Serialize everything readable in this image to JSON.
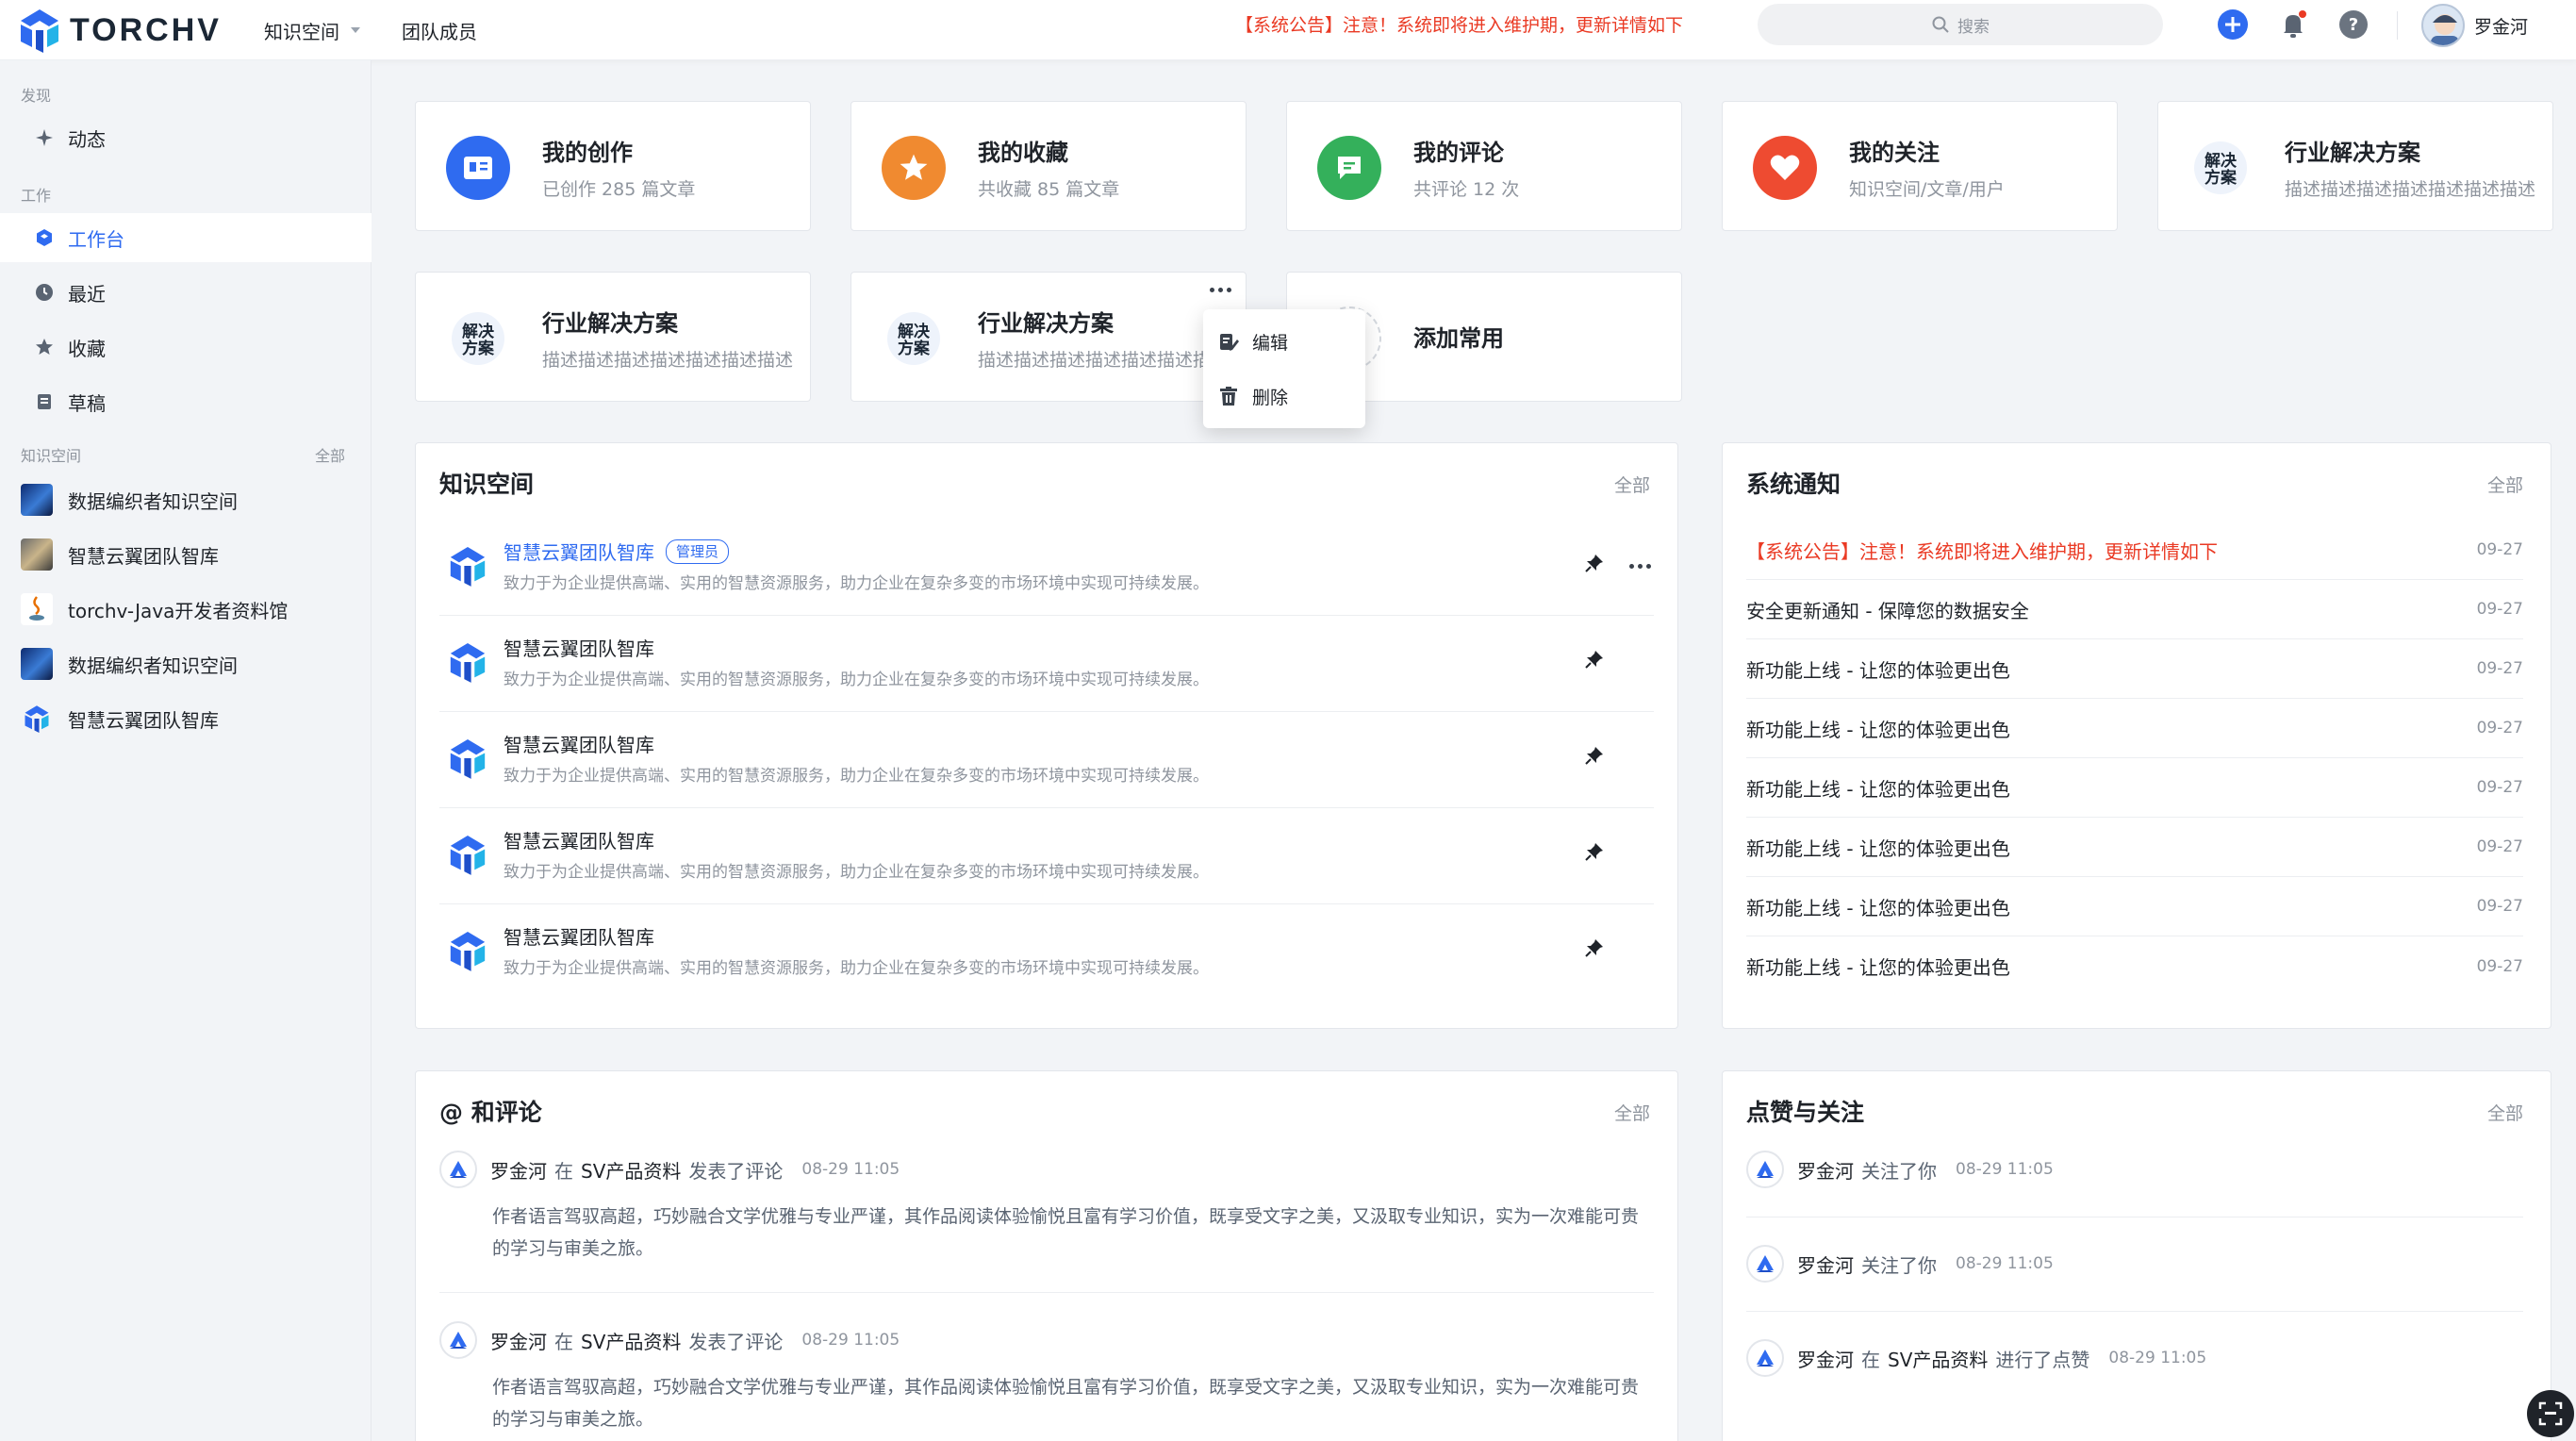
{
  "header": {
    "logo_text": "TORCHV",
    "nav": [
      {
        "label": "知识空间",
        "has_dropdown": true
      },
      {
        "label": "团队成员",
        "has_dropdown": false
      }
    ],
    "announcement": "【系统公告】注意！系统即将进入维护期，更新详情如下",
    "search_placeholder": "搜索",
    "user_name": "罗金河",
    "icons": [
      "plus-icon",
      "bell-icon",
      "help-icon"
    ]
  },
  "sidebar": {
    "section_discover": "发现",
    "discover_items": [
      {
        "label": "动态",
        "icon": "activity-icon"
      }
    ],
    "section_work": "工作",
    "work_items": [
      {
        "label": "工作台",
        "icon": "workbench-icon",
        "active": true
      },
      {
        "label": "最近",
        "icon": "clock-icon"
      },
      {
        "label": "收藏",
        "icon": "star-icon"
      },
      {
        "label": "草稿",
        "icon": "draft-icon"
      }
    ],
    "section_knowledge": "知识空间",
    "section_knowledge_all": "全部",
    "knowledge_spaces": [
      {
        "label": "数据编织者知识空间"
      },
      {
        "label": "智慧云翼团队智库"
      },
      {
        "label": "torchv-Java开发者资料馆"
      },
      {
        "label": "数据编织者知识空间"
      },
      {
        "label": "智慧云翼团队智库"
      }
    ]
  },
  "quick_cards": [
    {
      "title": "我的创作",
      "subtitle": "已创作 285 篇文章",
      "color": "#2f6bf0",
      "icon": "book-icon"
    },
    {
      "title": "我的收藏",
      "subtitle": "共收藏 85 篇文章",
      "color": "#f08a30",
      "icon": "star-icon"
    },
    {
      "title": "我的评论",
      "subtitle": "共评论 12 次",
      "color": "#34b05b",
      "icon": "comment-icon"
    },
    {
      "title": "我的关注",
      "subtitle": "知识空间/文章/用户",
      "color": "#ee4b31",
      "icon": "heart-icon"
    },
    {
      "title": "行业解决方案",
      "subtitle": "描述描述描述描述描述描述描述",
      "icon": "solution-logo"
    },
    {
      "title": "行业解决方案",
      "subtitle": "描述描述描述描述描述描述描述",
      "icon": "solution-logo"
    },
    {
      "title": "行业解决方案",
      "subtitle": "描述描述描述描述描述描述描述",
      "icon": "solution-logo"
    }
  ],
  "add_common": "添加常用",
  "context_menu": {
    "edit": "编辑",
    "delete": "删除"
  },
  "knowledge_panel": {
    "title": "知识空间",
    "all": "全部",
    "rows": [
      {
        "name": "智慧云翼团队智库",
        "badge": "管理员",
        "desc": "致力于为企业提供高端、实用的智慧资源服务，助力企业在复杂多变的市场环境中实现可持续发展。"
      },
      {
        "name": "智慧云翼团队智库",
        "desc": "致力于为企业提供高端、实用的智慧资源服务，助力企业在复杂多变的市场环境中实现可持续发展。"
      },
      {
        "name": "智慧云翼团队智库",
        "desc": "致力于为企业提供高端、实用的智慧资源服务，助力企业在复杂多变的市场环境中实现可持续发展。"
      },
      {
        "name": "智慧云翼团队智库",
        "desc": "致力于为企业提供高端、实用的智慧资源服务，助力企业在复杂多变的市场环境中实现可持续发展。"
      },
      {
        "name": "智慧云翼团队智库",
        "desc": "致力于为企业提供高端、实用的智慧资源服务，助力企业在复杂多变的市场环境中实现可持续发展。"
      }
    ]
  },
  "notice_panel": {
    "title": "系统通知",
    "all": "全部",
    "rows": [
      {
        "text": "【系统公告】注意！系统即将进入维护期，更新详情如下",
        "date": "09-27",
        "highlight": true
      },
      {
        "text": "安全更新通知 - 保障您的数据安全",
        "date": "09-27"
      },
      {
        "text": "新功能上线 - 让您的体验更出色",
        "date": "09-27"
      },
      {
        "text": "新功能上线 - 让您的体验更出色",
        "date": "09-27"
      },
      {
        "text": "新功能上线 - 让您的体验更出色",
        "date": "09-27"
      },
      {
        "text": "新功能上线 - 让您的体验更出色",
        "date": "09-27"
      },
      {
        "text": "新功能上线 - 让您的体验更出色",
        "date": "09-27"
      },
      {
        "text": "新功能上线 - 让您的体验更出色",
        "date": "09-27"
      }
    ]
  },
  "comments_panel": {
    "title": "@ 和评论",
    "all": "全部",
    "rows": [
      {
        "user": "罗金河",
        "in": "在",
        "target": "SV产品资料",
        "action": "发表了评论",
        "time": "08-29 11:05",
        "text": "作者语言驾驭高超，巧妙融合文学优雅与专业严谨，其作品阅读体验愉悦且富有学习价值，既享受文字之美，又汲取专业知识，实为一次难能可贵的学习与审美之旅。"
      },
      {
        "user": "罗金河",
        "in": "在",
        "target": "SV产品资料",
        "action": "发表了评论",
        "time": "08-29 11:05",
        "text": "作者语言驾驭高超，巧妙融合文学优雅与专业严谨，其作品阅读体验愉悦且富有学习价值，既享受文字之美，又汲取专业知识，实为一次难能可贵的学习与审美之旅。"
      }
    ]
  },
  "likes_panel": {
    "title": "点赞与关注",
    "all": "全部",
    "rows": [
      {
        "user": "罗金河",
        "action": "关注了你",
        "time": "08-29 11:05"
      },
      {
        "user": "罗金河",
        "action": "关注了你",
        "time": "08-29 11:05"
      },
      {
        "user": "罗金河",
        "in": "在",
        "target": "SV产品资料",
        "action": "进行了点赞",
        "time": "08-29 11:05"
      }
    ]
  }
}
